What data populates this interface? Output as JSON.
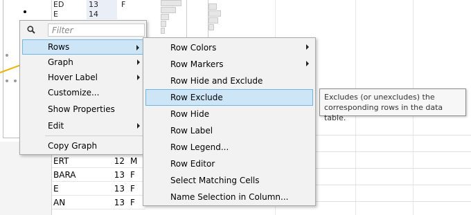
{
  "background": {
    "top_rows": [
      {
        "name": "ED",
        "age": "13",
        "sex": "F"
      },
      {
        "name": "E",
        "age": "14",
        "sex": ""
      }
    ],
    "bottom_rows": [
      {
        "name": "ERT",
        "age": "12",
        "sex": "M"
      },
      {
        "name": "BARA",
        "age": "13",
        "sex": "F"
      },
      {
        "name": "E",
        "age": "13",
        "sex": "F"
      },
      {
        "name": "AN",
        "age": "13",
        "sex": "F"
      }
    ],
    "accent_line_color": "#f0b400"
  },
  "context_menu": {
    "search_icon": "search-icon",
    "filter_placeholder": "Filter",
    "items": [
      {
        "label": "Rows",
        "has_submenu": true,
        "selected": true
      },
      {
        "label": "Graph",
        "has_submenu": true
      },
      {
        "label": "Hover Label",
        "has_submenu": true
      },
      {
        "label": "Customize...",
        "has_submenu": false
      },
      {
        "label": "Show Properties",
        "has_submenu": false
      },
      {
        "label": "Edit",
        "has_submenu": true
      },
      {
        "label": "Copy Graph",
        "has_submenu": false
      }
    ]
  },
  "rows_submenu": {
    "items": [
      {
        "label": "Row Colors",
        "has_submenu": true
      },
      {
        "label": "Row Markers",
        "has_submenu": true
      },
      {
        "label": "Row Hide and Exclude",
        "has_submenu": false
      },
      {
        "label": "Row Exclude",
        "has_submenu": false,
        "selected": true
      },
      {
        "label": "Row Hide",
        "has_submenu": false
      },
      {
        "label": "Row Label",
        "has_submenu": false
      },
      {
        "label": "Row Legend...",
        "has_submenu": false
      },
      {
        "label": "Row Editor",
        "has_submenu": false
      },
      {
        "label": "Select Matching Cells",
        "has_submenu": false
      },
      {
        "label": "Name Selection in Column...",
        "has_submenu": false
      }
    ]
  },
  "tooltip": {
    "line1": "Excludes (or unexcludes) the",
    "line2": "corresponding rows in the data table."
  },
  "colors": {
    "menu_bg": "#f2f2f2",
    "selection_bg": "#cde6f7",
    "selection_border": "#6fb4e3"
  }
}
